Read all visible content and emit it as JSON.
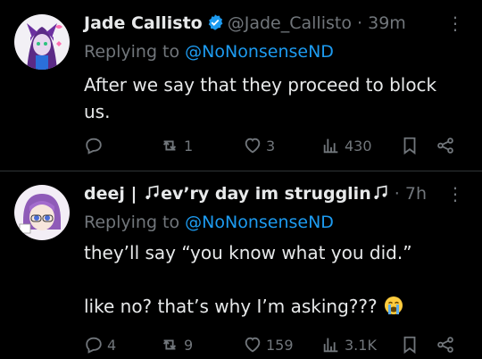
{
  "colors": {
    "background": "#000000",
    "text": "#e7e9ea",
    "muted": "#71767b",
    "link": "#1d9bf0",
    "verified": "#1d9bf0",
    "divider": "#2f3336"
  },
  "tweets": [
    {
      "name": "Jade Callisto",
      "verified": true,
      "handle": "@Jade_Callisto",
      "separator": "·",
      "time": "39m",
      "replying_prefix": "Replying to ",
      "replying_to": "@NoNonsenseND",
      "text": "After we say that they proceed to block us.",
      "more_icon": "⋮",
      "actions": {
        "replies": "",
        "retweets": "1",
        "likes": "3",
        "views": "430"
      }
    },
    {
      "name_left": "deej | ",
      "name_mid": "ev’ry day im strugglin",
      "handle": "",
      "separator": "·",
      "time": "7h",
      "replying_prefix": "Replying to ",
      "replying_to": "@NoNonsenseND",
      "text_line1": "they’ll say “you know what you did.”",
      "text_line2": "like no? that’s why I’m asking???",
      "emoji": "loudly-crying-face",
      "more_icon": "⋮",
      "actions": {
        "replies": "4",
        "retweets": "9",
        "likes": "159",
        "views": "3.1K"
      }
    }
  ]
}
